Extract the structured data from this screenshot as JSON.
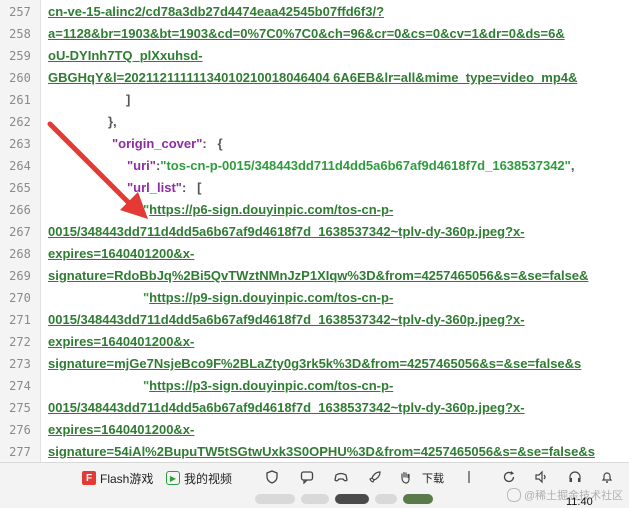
{
  "lines": [
    {
      "num": "257",
      "indent": 48,
      "parts": [
        {
          "t": "cn-ve-15-alinc2/cd78a3db27d4474eaa42545b07ffd6f3/?",
          "k": "link"
        }
      ]
    },
    {
      "num": "258",
      "indent": 48,
      "parts": [
        {
          "t": "a=1128&br=1903&bt=1903&cd=0%7C0%7C0&ch=96&cr=0&cs=0&cv=1&dr=0&ds=6&",
          "k": "link"
        }
      ]
    },
    {
      "num": "259",
      "indent": 48,
      "parts": [
        {
          "t": "oU-DYInh7TQ_plXxuhsd-",
          "k": "link"
        }
      ]
    },
    {
      "num": "260",
      "indent": 48,
      "parts": [
        {
          "t": "GBGHqY&l=20211211111134010210018046404 6A6EB&lr=all&mime_type=video_mp4&",
          "k": "link"
        }
      ]
    },
    {
      "num": "261",
      "indent": 126,
      "parts": [
        {
          "t": "]",
          "k": "punct"
        }
      ]
    },
    {
      "num": "262",
      "indent": 108,
      "parts": [
        {
          "t": "},",
          "k": "punct"
        }
      ]
    },
    {
      "num": "263",
      "indent": 112,
      "parts": [
        {
          "t": "\"origin_cover\"",
          "k": "key"
        },
        {
          "t": ":   {",
          "k": "punct"
        }
      ]
    },
    {
      "num": "264",
      "indent": 127,
      "parts": [
        {
          "t": "\"uri\"",
          "k": "key"
        },
        {
          "t": ":",
          "k": "punct"
        },
        {
          "t": "\"tos-cn-p-0015/348443dd711d4dd5a6b67af9d4618f7d_1638537342\"",
          "k": "str"
        },
        {
          "t": ",",
          "k": "punct"
        }
      ]
    },
    {
      "num": "265",
      "indent": 127,
      "parts": [
        {
          "t": "\"url_list\"",
          "k": "key"
        },
        {
          "t": ":   [",
          "k": "punct"
        }
      ]
    },
    {
      "num": "266",
      "indent": 143,
      "parts": [
        {
          "t": "\"",
          "k": "str"
        },
        {
          "t": "https://p6-sign.douyinpic.com/tos-cn-p-",
          "k": "link"
        }
      ]
    },
    {
      "num": "267",
      "indent": 48,
      "parts": [
        {
          "t": "0015/348443dd711d4dd5a6b67af9d4618f7d_1638537342~tplv-dy-360p.jpeg?x-",
          "k": "link"
        }
      ]
    },
    {
      "num": "268",
      "indent": 48,
      "parts": [
        {
          "t": "expires=1640401200&x-",
          "k": "link"
        }
      ]
    },
    {
      "num": "269",
      "indent": 48,
      "parts": [
        {
          "t": "signature=RdoBbJq%2Bi5QvTWztNMnJzP1XIqw%3D&from=4257465056&s=&se=false&",
          "k": "link"
        }
      ]
    },
    {
      "num": "270",
      "indent": 143,
      "parts": [
        {
          "t": "\"",
          "k": "str"
        },
        {
          "t": "https://p9-sign.douyinpic.com/tos-cn-p-",
          "k": "link"
        }
      ]
    },
    {
      "num": "271",
      "indent": 48,
      "parts": [
        {
          "t": "0015/348443dd711d4dd5a6b67af9d4618f7d_1638537342~tplv-dy-360p.jpeg?x-",
          "k": "link"
        }
      ]
    },
    {
      "num": "272",
      "indent": 48,
      "parts": [
        {
          "t": "expires=1640401200&x-",
          "k": "link"
        }
      ]
    },
    {
      "num": "273",
      "indent": 48,
      "parts": [
        {
          "t": "signature=mjGe7NsjeBco9F%2BLaZty0g3rk5k%3D&from=4257465056&s=&se=false&s",
          "k": "link"
        }
      ]
    },
    {
      "num": "274",
      "indent": 143,
      "parts": [
        {
          "t": "\"",
          "k": "str"
        },
        {
          "t": "https://p3-sign.douyinpic.com/tos-cn-p-",
          "k": "link"
        }
      ]
    },
    {
      "num": "275",
      "indent": 48,
      "parts": [
        {
          "t": "0015/348443dd711d4dd5a6b67af9d4618f7d_1638537342~tplv-dy-360p.jpeg?x-",
          "k": "link"
        }
      ]
    },
    {
      "num": "276",
      "indent": 48,
      "parts": [
        {
          "t": "expires=1640401200&x-",
          "k": "link"
        }
      ]
    },
    {
      "num": "277",
      "indent": 48,
      "parts": [
        {
          "t": "signature=54iAl%2BupuTW5tSGtwUxk3S0OPHU%3D&from=4257465056&s=&se=false&s",
          "k": "link"
        }
      ]
    }
  ],
  "taskbar": {
    "flash_label": "Flash游戏",
    "flash_icon": "F",
    "video_label": "我的视频",
    "video_icon": "▶",
    "download_label": "下载",
    "clock": "11:40",
    "watermark": "@稀土掘金技术社区"
  },
  "colors": {
    "link": "#2e7d32",
    "key": "#8e2ba6",
    "string": "#2e9c3c",
    "arrow": "#e53935"
  }
}
